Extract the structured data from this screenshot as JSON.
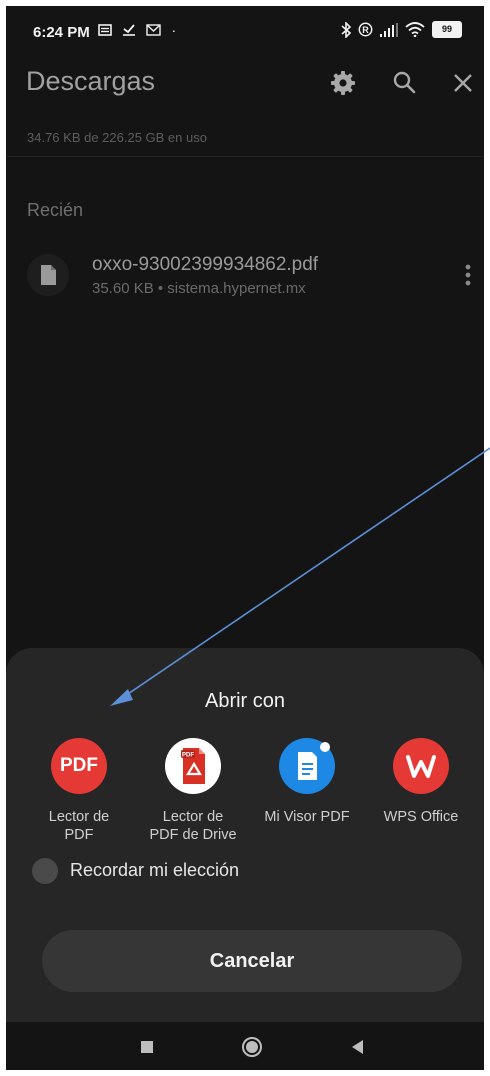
{
  "status_bar": {
    "time": "6:24 PM",
    "battery": "99"
  },
  "header": {
    "title": "Descargas",
    "storage_usage": "34.76 KB de 226.25 GB en uso"
  },
  "section_label": "Recién",
  "file": {
    "name": "oxxo-93002399934862.pdf",
    "meta": "35.60 KB • sistema.hypernet.mx"
  },
  "open_with": {
    "title": "Abrir con",
    "apps": [
      {
        "label": "Lector de\nPDF",
        "icon": "pdf-reader-icon",
        "icon_text": "PDF",
        "color": "#e53935"
      },
      {
        "label": "Lector de\nPDF de Drive",
        "icon": "drive-pdf-icon",
        "icon_text": "PDF",
        "color": "#ffffff"
      },
      {
        "label": "Mi Visor PDF",
        "icon": "mi-pdf-viewer-icon",
        "icon_text": "",
        "color": "#1e88e5"
      },
      {
        "label": "WPS Office",
        "icon": "wps-office-icon",
        "icon_text": "W",
        "color": "#e53935"
      }
    ],
    "remember_label": "Recordar mi elección",
    "cancel_label": "Cancelar"
  },
  "colors": {
    "background": "#141414",
    "sheet": "#262626",
    "arrow": "#5b8fd6"
  }
}
